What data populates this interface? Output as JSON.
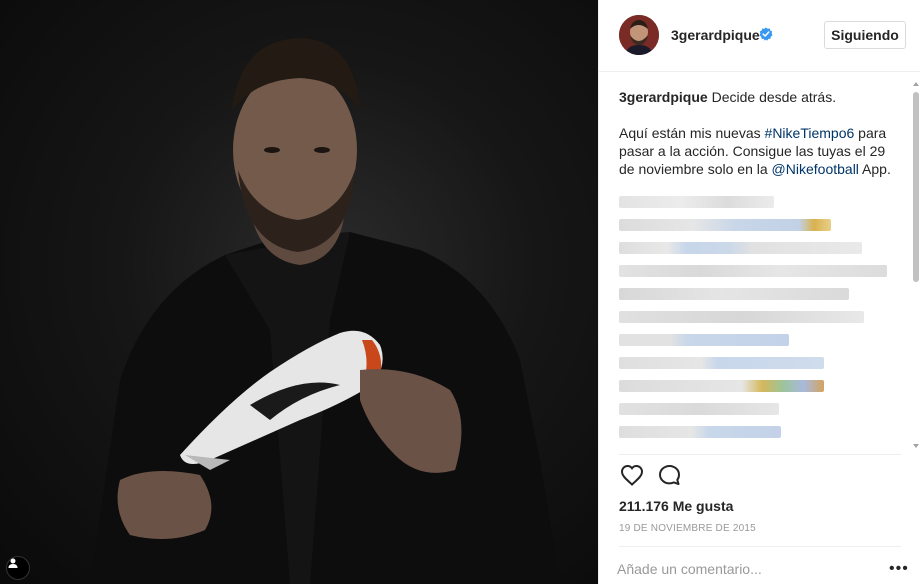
{
  "post": {
    "username": "3gerardpique",
    "follow_label": "Siguiendo",
    "caption": {
      "username": "3gerardpique",
      "line1": "Decide desde atrás.",
      "p2_a": "Aquí están mis nuevas ",
      "hashtag": "#NikeTiempo6",
      "p2_b": " para pasar a la acción. Consigue las tuyas el 29 de noviembre solo en la ",
      "mention": "@Nikefootball",
      "p2_c": " App."
    },
    "likes": "211.176 Me gusta",
    "date": "19 DE NOVIEMBRE DE 2015",
    "comment_placeholder": "Añade un comentario...",
    "more_label": "•••"
  },
  "colors": {
    "link": "#003569",
    "verified": "#3897f0",
    "border": "#efefef",
    "muted": "#999999"
  },
  "icons": [
    "verified-badge-icon",
    "heart-icon",
    "comment-icon",
    "user-tag-icon",
    "more-options-icon"
  ]
}
